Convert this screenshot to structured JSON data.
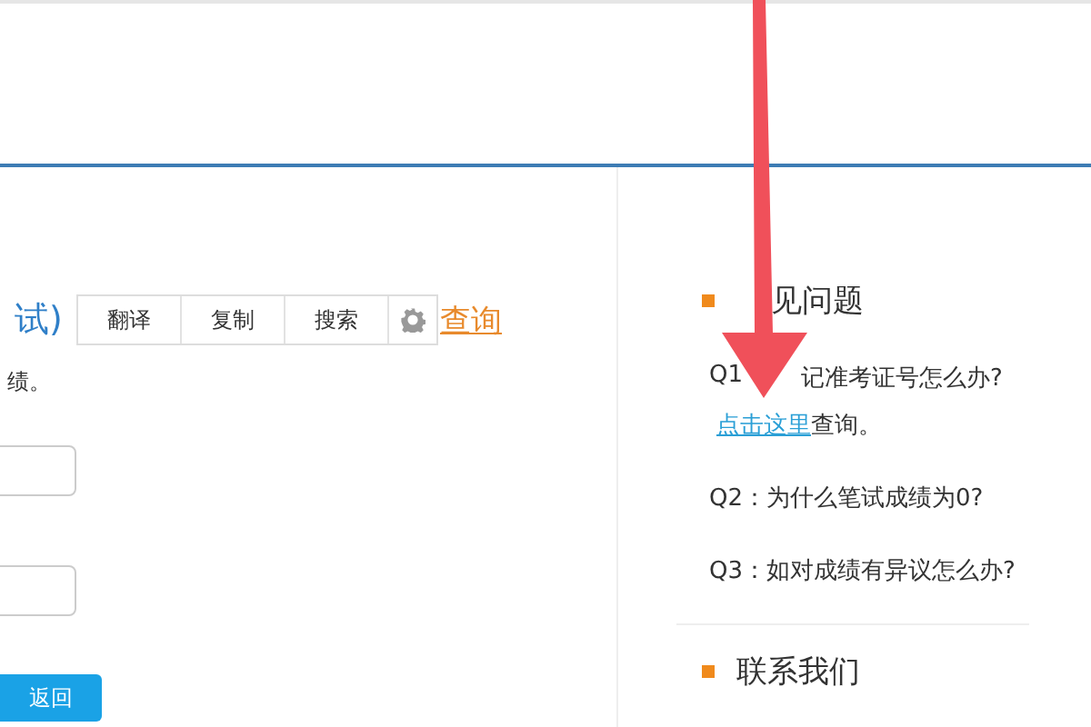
{
  "main": {
    "title": "试)",
    "context_menu": [
      {
        "kind": "text",
        "label": "翻译"
      },
      {
        "kind": "text",
        "label": "复制"
      },
      {
        "kind": "text",
        "label": "搜索"
      },
      {
        "kind": "gear"
      }
    ],
    "link": "查询",
    "intro": "绩。",
    "fields": [
      {
        "kind": "input"
      },
      {
        "kind": "input"
      }
    ],
    "button": "返回"
  },
  "sidebar": {
    "faq_title": "见问题",
    "questions": [
      {
        "text_parts": [
          "Q1",
          "记准考证号怎么办?"
        ],
        "answer_link": "点击这里",
        "answer_text": "查询。"
      },
      {
        "text_parts": [
          "Q2：为什么笔试成绩为0?"
        ]
      },
      {
        "text_parts": [
          "Q3：如对成绩有异议怎么办?"
        ]
      }
    ],
    "contact_title": "联系我们"
  }
}
